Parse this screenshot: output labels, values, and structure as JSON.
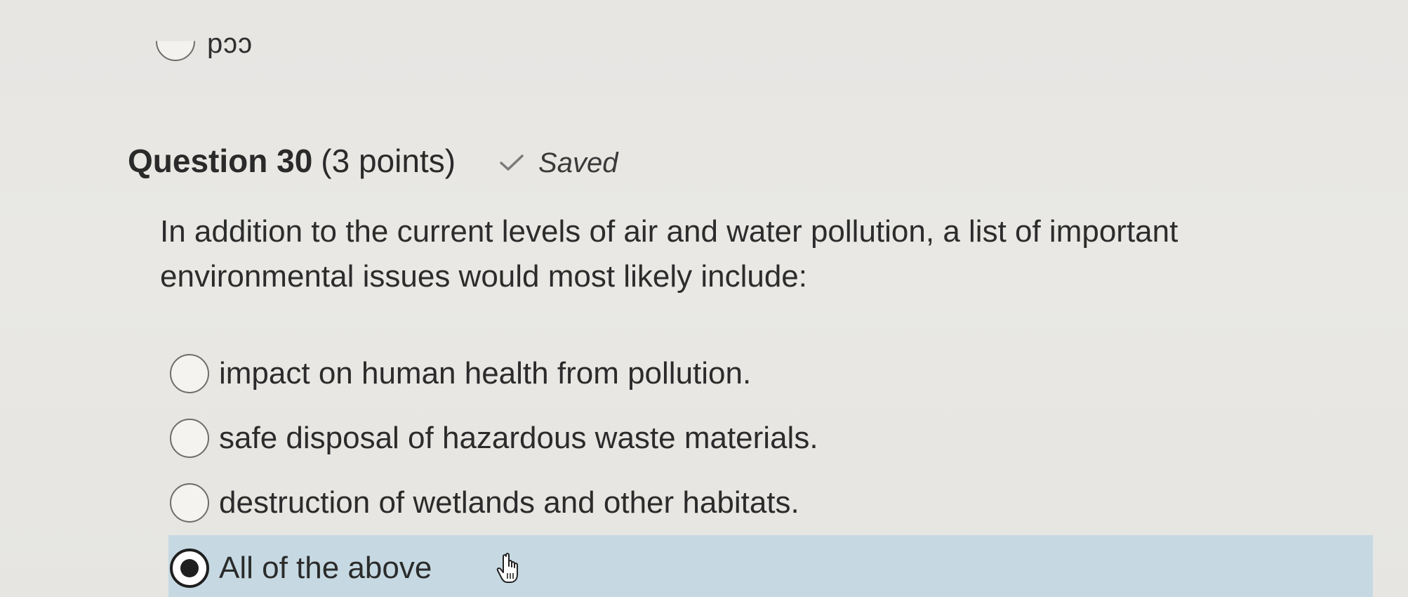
{
  "previous_question": {
    "option_label": "ccd"
  },
  "question": {
    "title": "Question 30",
    "points": "(3 points)",
    "status": "Saved",
    "status_icon": "check-icon",
    "text": "In addition to the current levels of air and water pollution, a list of important environmental issues would most likely include:"
  },
  "options": [
    {
      "label": "impact on human health from pollution.",
      "selected": false
    },
    {
      "label": "safe disposal of hazardous waste materials.",
      "selected": false
    },
    {
      "label": "destruction of wetlands and other habitats.",
      "selected": false
    },
    {
      "label": "All of the above",
      "selected": true
    }
  ],
  "colors": {
    "selected_background": "#c6d9e3",
    "page_background": "#e8e7e4"
  },
  "cursor": "hand-pointer-icon"
}
